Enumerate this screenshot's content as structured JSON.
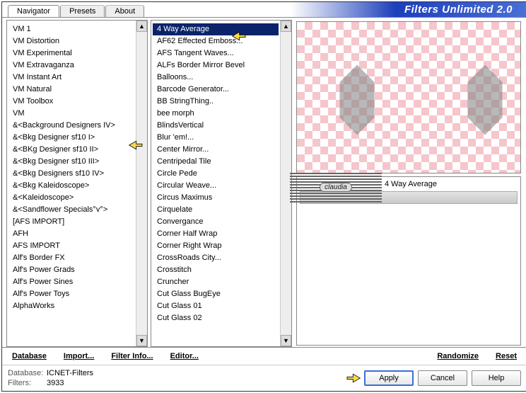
{
  "title": "Filters Unlimited 2.0",
  "tabs": {
    "navigator": "Navigator",
    "presets": "Presets",
    "about": "About"
  },
  "categories": [
    "VM 1",
    "VM Distortion",
    "VM Experimental",
    "VM Extravaganza",
    "VM Instant Art",
    "VM Natural",
    "VM Toolbox",
    "VM",
    "&<Background Designers IV>",
    "&<Bkg Designer sf10 I>",
    "&<BKg Designer sf10 II>",
    "&<Bkg Designer sf10 III>",
    "&<Bkg Designers sf10 IV>",
    "&<Bkg Kaleidoscope>",
    "&<Kaleidoscope>",
    "&<Sandflower Specials°v°>",
    "[AFS IMPORT]",
    "AFH",
    "AFS IMPORT",
    "Alf's Border FX",
    "Alf's Power Grads",
    "Alf's Power Sines",
    "Alf's Power Toys",
    "AlphaWorks"
  ],
  "category_selected_index": 9,
  "filters": [
    "4 Way Average",
    "AF62 Effected Emboss...",
    "AFS Tangent Waves...",
    "ALFs Border Mirror Bevel",
    "Balloons...",
    "Barcode Generator...",
    "BB StringThing..",
    "bee morph",
    "BlindsVertical",
    "Blur 'em!...",
    "Center Mirror...",
    "Centripedal Tile",
    "Circle Pede",
    "Circular Weave...",
    "Circus Maximus",
    "Cirquelate",
    "Convergance",
    "Corner Half Wrap",
    "Corner Right Wrap",
    "CrossRoads City...",
    "Crosstitch",
    "Cruncher",
    "Cut Glass  BugEye",
    "Cut Glass 01",
    "Cut Glass 02"
  ],
  "filter_selected_index": 0,
  "selected_filter_name": "4 Way Average",
  "watermark": "claudia",
  "bottom": {
    "database": "Database",
    "import": "Import...",
    "filter_info": "Filter Info...",
    "editor": "Editor...",
    "randomize": "Randomize",
    "reset": "Reset"
  },
  "status": {
    "db_label": "Database:",
    "db_value": "ICNET-Filters",
    "filters_label": "Filters:",
    "filters_value": "3933"
  },
  "buttons": {
    "apply": "Apply",
    "cancel": "Cancel",
    "help": "Help"
  }
}
